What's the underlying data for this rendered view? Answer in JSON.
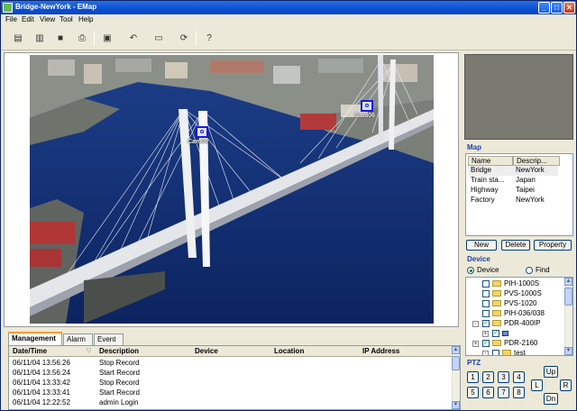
{
  "window": {
    "title": "Bridge-NewYork - EMap",
    "minimize_glyph": "_",
    "maximize_glyph": "□",
    "close_glyph": "✕"
  },
  "menu": [
    "File",
    "Edit",
    "View",
    "Tool",
    "Help"
  ],
  "toolbar": [
    {
      "name": "new-icon",
      "glyph": "▤"
    },
    {
      "name": "open-icon",
      "glyph": "▥"
    },
    {
      "name": "save-icon",
      "glyph": "■"
    },
    {
      "name": "print-icon",
      "glyph": "⎙"
    },
    {
      "name": "properties-icon",
      "glyph": "▣"
    },
    {
      "name": "undo-icon",
      "glyph": "↶"
    },
    {
      "name": "layout-icon",
      "glyph": "▭"
    },
    {
      "name": "refresh-icon",
      "glyph": "⟳"
    },
    {
      "name": "help-icon",
      "glyph": "?"
    }
  ],
  "map_view": {
    "cameras": [
      {
        "label": "Cam00"
      },
      {
        "label": "Cam06"
      }
    ]
  },
  "map_panel": {
    "title": "Map",
    "columns": [
      "Name",
      "Descrip..."
    ],
    "rows": [
      {
        "name": "Bridge",
        "desc": "NewYork",
        "selected": true
      },
      {
        "name": "Train sta...",
        "desc": "Japan",
        "selected": false
      },
      {
        "name": "Highway",
        "desc": "Taipei",
        "selected": false
      },
      {
        "name": "Factory",
        "desc": "NewYork",
        "selected": false
      }
    ],
    "buttons": [
      "New",
      "Delete",
      "Property"
    ]
  },
  "device_panel": {
    "title": "Device",
    "radio_device": "Device",
    "radio_find": "Find",
    "selected_radio": "Device",
    "tree": [
      {
        "label": "PIH-1000S",
        "expander": "",
        "checked": false
      },
      {
        "label": "PVS-1000S",
        "expander": "",
        "checked": false
      },
      {
        "label": "PVS-1020",
        "expander": "",
        "checked": false
      },
      {
        "label": "PIH-036/038",
        "expander": "",
        "checked": false
      },
      {
        "label": "PDR-400IP",
        "expander": "-",
        "checked": true
      },
      {
        "label": "",
        "expander": "+",
        "checked": true
      },
      {
        "label": "PDR-2160",
        "expander": "+",
        "checked": true
      },
      {
        "label": "test",
        "expander": "-",
        "checked": false
      }
    ]
  },
  "ptz": {
    "title": "PTZ",
    "presets": [
      "1",
      "2",
      "3",
      "4",
      "5",
      "6",
      "7",
      "8"
    ],
    "up": "Up",
    "down": "Dn",
    "left": "L",
    "right": "R"
  },
  "bottom": {
    "tabs": [
      "Management",
      "Alarm",
      "Event"
    ],
    "active_tab": "Management",
    "columns": [
      "Date/Time",
      "Description",
      "Device",
      "Location",
      "IP Address"
    ],
    "rows": [
      {
        "datetime": "06/11/04 13:56:26",
        "description": "Stop Record"
      },
      {
        "datetime": "06/11/04 13:56:24",
        "description": "Start Record"
      },
      {
        "datetime": "06/11/04 13:33:42",
        "description": "Stop Record"
      },
      {
        "datetime": "06/11/04 13:33:41",
        "description": "Start Record"
      },
      {
        "datetime": "06/11/04 12:22:52",
        "description": "admin Login"
      }
    ]
  }
}
